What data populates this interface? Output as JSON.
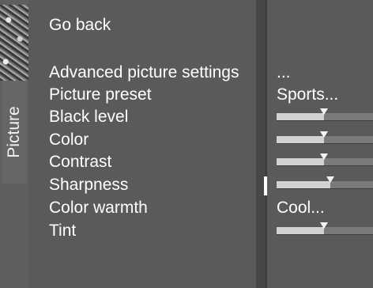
{
  "sidebar": {
    "tab_label": "Picture"
  },
  "menu": {
    "go_back": "Go back",
    "items": [
      {
        "label": "Advanced picture settings",
        "value": "..."
      },
      {
        "label": "Picture preset",
        "value": "Sports..."
      },
      {
        "label": "Black level",
        "slider": 0.49
      },
      {
        "label": "Color",
        "slider": 0.49
      },
      {
        "label": "Contrast",
        "slider": 0.49
      },
      {
        "label": "Sharpness",
        "slider": 0.56
      },
      {
        "label": "Color warmth",
        "value": "Cool..."
      },
      {
        "label": "Tint",
        "slider": 0.49
      }
    ]
  },
  "colors": {
    "background": "#4f4f4f",
    "text": "#ffffff",
    "slider_fill": "#d2d2d2",
    "slider_track": "#7a7a7a"
  }
}
